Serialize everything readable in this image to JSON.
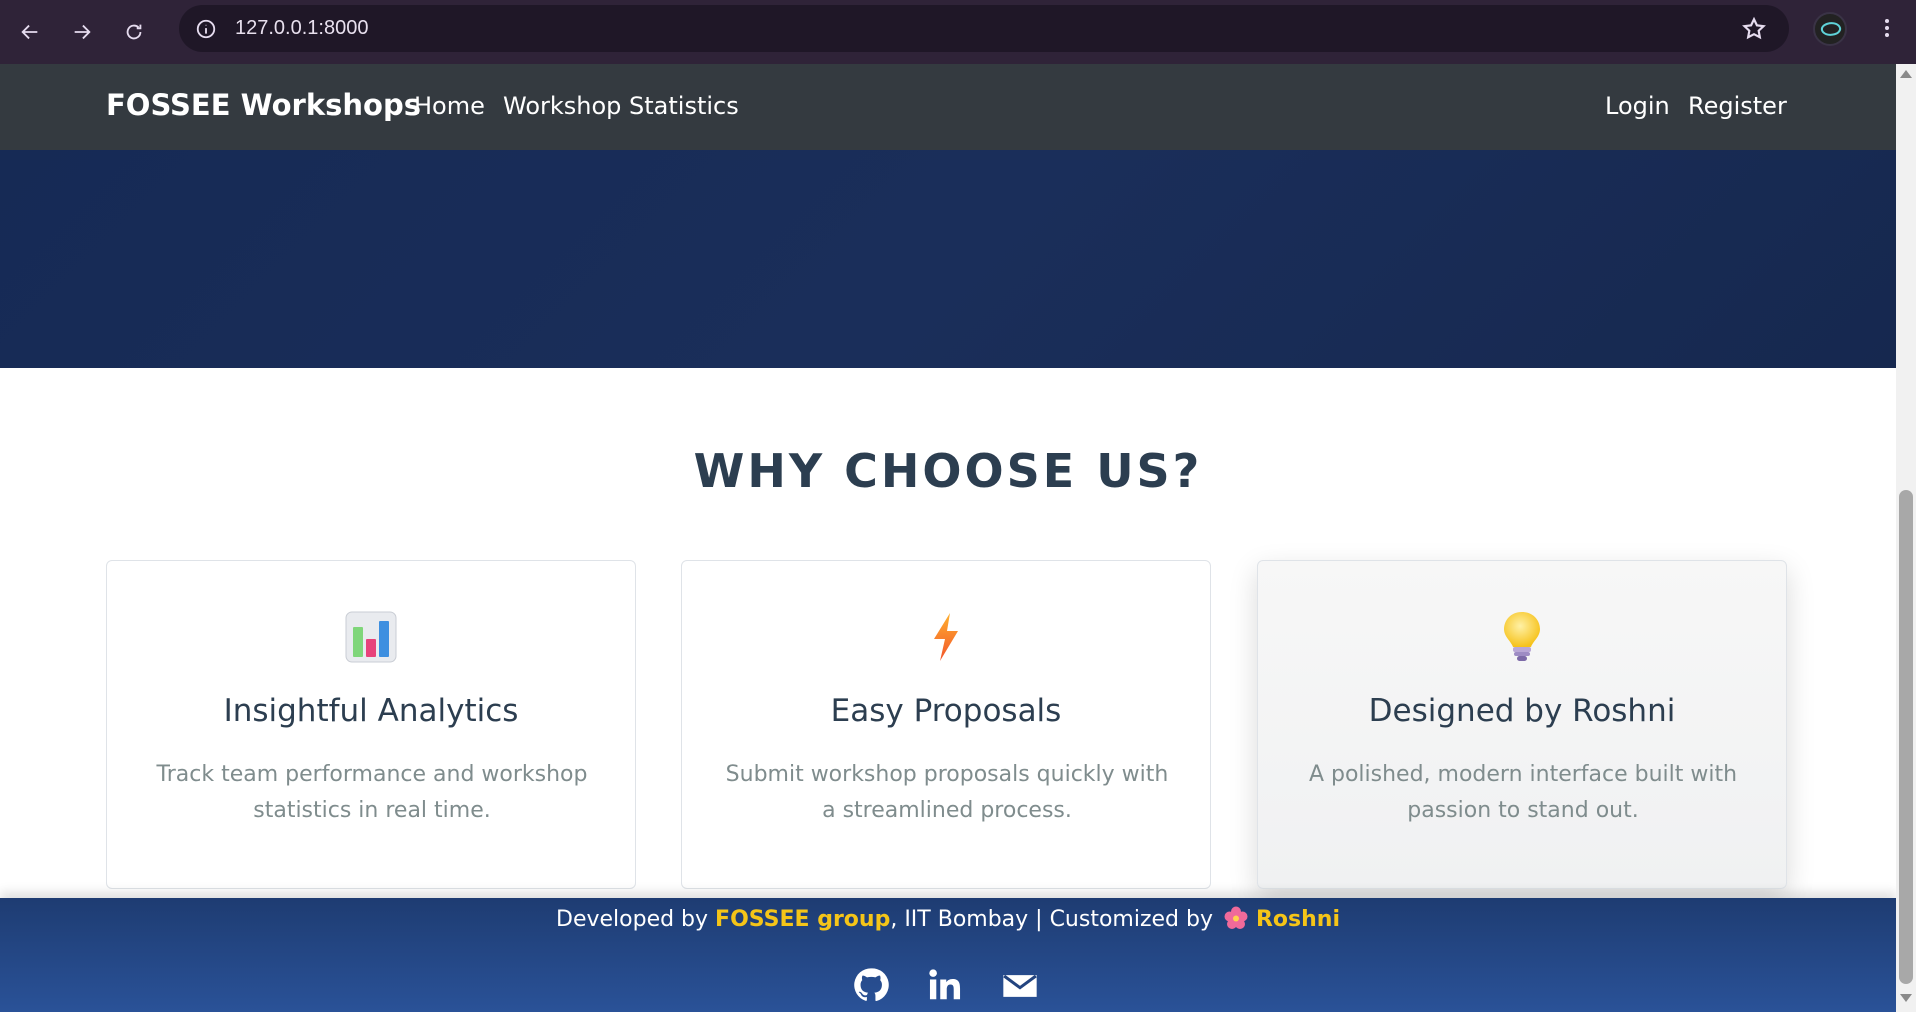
{
  "browser": {
    "url": "127.0.0.1:8000",
    "icons": [
      "back-arrow-icon",
      "forward-arrow-icon",
      "reload-icon",
      "site-info-icon",
      "bookmark-star-icon",
      "profile-avatar",
      "more-menu-icon"
    ]
  },
  "navbar": {
    "brand": "FOSSEE Workshops",
    "links": [
      "Home",
      "Workshop Statistics"
    ],
    "right_links": [
      "Login",
      "Register"
    ],
    "bg_color": "#343a40"
  },
  "hero": {
    "bg_color": "#162a55"
  },
  "section": {
    "title": "WHY CHOOSE US?",
    "cards": [
      {
        "icon": "bar-chart-icon",
        "title": "Insightful Analytics",
        "desc": "Track team performance and workshop statistics in real time."
      },
      {
        "icon": "lightning-icon",
        "title": "Easy Proposals",
        "desc": "Submit workshop proposals quickly with a streamlined process."
      },
      {
        "icon": "lightbulb-icon",
        "title": "Designed by Roshni",
        "desc": "A polished, modern interface built with passion to stand out."
      }
    ]
  },
  "footer": {
    "text_prefix": "Developed by ",
    "group": "FOSSEE group",
    "text_middle": ", IIT Bombay | Customized by ",
    "author": "Roshni",
    "highlight_color": "#f5c518",
    "social_icons": [
      "github-icon",
      "linkedin-icon",
      "email-icon"
    ]
  }
}
